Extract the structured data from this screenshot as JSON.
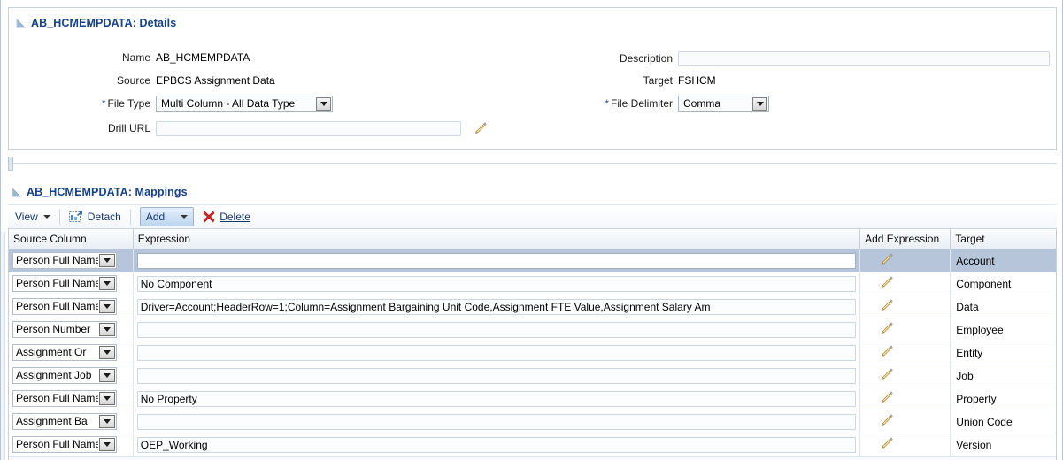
{
  "details": {
    "title": "AB_HCMEMPDATA: Details",
    "disclosure_icon": "triangle-expanded-icon",
    "fields": {
      "name_label": "Name",
      "name_value": "AB_HCMEMPDATA",
      "source_label": "Source",
      "source_value": "EPBCS Assignment Data",
      "file_type_label": "File Type",
      "file_type_value": "Multi Column - All Data Type",
      "drill_url_label": "Drill URL",
      "drill_url_value": "",
      "drill_url_edit_icon": "pencil-icon",
      "description_label": "Description",
      "description_value": "",
      "target_label": "Target",
      "target_value": "FSHCM",
      "file_delimiter_label": "File Delimiter",
      "file_delimiter_value": "Comma",
      "required_marker": "*"
    }
  },
  "mappings": {
    "title": "AB_HCMEMPDATA: Mappings",
    "disclosure_icon": "triangle-expanded-icon",
    "toolbar": {
      "view_label": "View",
      "detach_label": "Detach",
      "detach_icon": "detach-icon",
      "add_label": "Add",
      "delete_label": "Delete",
      "delete_icon": "red-x-icon"
    },
    "columns": {
      "source_column": "Source Column",
      "expression": "Expression",
      "add_expression": "Add Expression",
      "target": "Target"
    },
    "rows": [
      {
        "source_column": "Person Full Name",
        "expression": "",
        "add_expression_icon": "pencil-icon",
        "target": "Account",
        "selected": true
      },
      {
        "source_column": "Person Full Name",
        "expression": "No Component",
        "add_expression_icon": "pencil-icon",
        "target": "Component",
        "selected": false
      },
      {
        "source_column": "Person Full Name",
        "expression": "Driver=Account;HeaderRow=1;Column=Assignment Bargaining Unit Code,Assignment FTE Value,Assignment Salary Am",
        "add_expression_icon": "pencil-icon",
        "target": "Data",
        "selected": false
      },
      {
        "source_column": "Person Number",
        "expression": "",
        "add_expression_icon": "pencil-icon",
        "target": "Employee",
        "selected": false
      },
      {
        "source_column": "Assignment Or",
        "expression": "",
        "add_expression_icon": "pencil-icon",
        "target": "Entity",
        "selected": false
      },
      {
        "source_column": "Assignment Job",
        "expression": "",
        "add_expression_icon": "pencil-icon",
        "target": "Job",
        "selected": false
      },
      {
        "source_column": "Person Full Name",
        "expression": "No Property",
        "add_expression_icon": "pencil-icon",
        "target": "Property",
        "selected": false
      },
      {
        "source_column": "Assignment Ba",
        "expression": "",
        "add_expression_icon": "pencil-icon",
        "target": "Union Code",
        "selected": false
      },
      {
        "source_column": "Person Full Name",
        "expression": "OEP_Working",
        "add_expression_icon": "pencil-icon",
        "target": "Version",
        "selected": false
      }
    ]
  },
  "colors": {
    "title_blue": "#15428b",
    "selected_row": "#b6c5da",
    "panel_border": "#c8d4e0",
    "link_blue": "#16366b",
    "delete_red": "#cc2222",
    "pencil_gold": "#e8a317"
  }
}
